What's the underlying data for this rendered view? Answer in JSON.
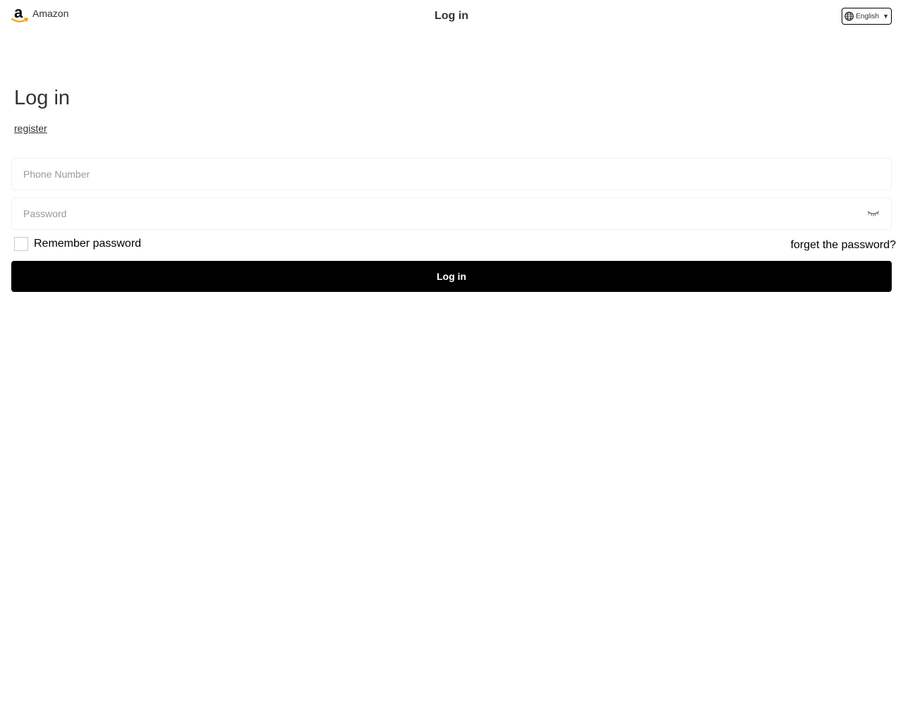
{
  "header": {
    "brand_name": "Amazon",
    "logo_icon": "amazon-logo",
    "title": "Log in",
    "language": {
      "icon": "globe-icon",
      "selected": "English",
      "caret": "▼"
    }
  },
  "main": {
    "heading": "Log in",
    "register_link": "register",
    "phone_field": {
      "placeholder": "Phone Number",
      "value": ""
    },
    "password_field": {
      "placeholder": "Password",
      "value": "",
      "toggle_icon": "eye-closed-icon"
    },
    "remember_label": "Remember password",
    "remember_checked": false,
    "forgot_link": "forget the password?",
    "login_button": "Log in"
  },
  "colors": {
    "primary_button": "#000000",
    "logo_accent": "#ff9900",
    "text": "#333333"
  }
}
